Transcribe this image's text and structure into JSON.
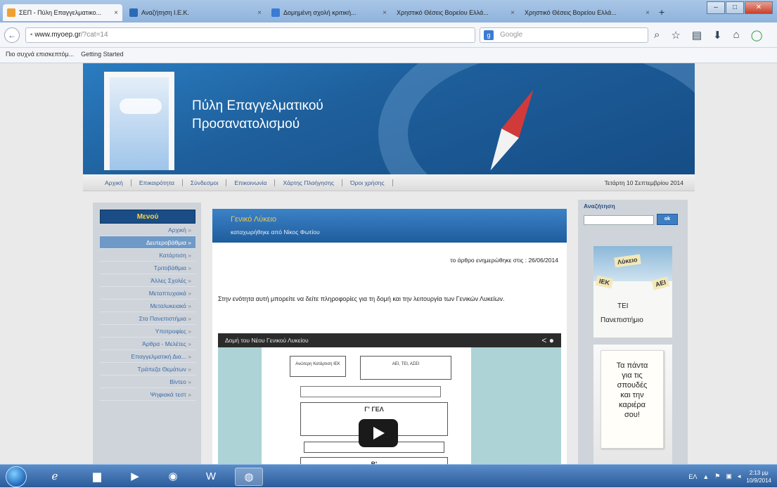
{
  "browser": {
    "tabs": [
      {
        "label": "ΣΕΠ - Πύλη Επαγγελματικο...",
        "active": true,
        "favicon_color": "#f0a030"
      },
      {
        "label": "Αναζήτηση Ι.Ε.Κ.",
        "active": false,
        "favicon_color": "#2a6bb5"
      },
      {
        "label": "Δομημένη σχολή κριτική...",
        "active": false,
        "favicon_color": "#3a7bd5"
      },
      {
        "label": "Χρηστικό Θέσεις Βορείου Ελλά...",
        "active": false,
        "favicon_color": ""
      },
      {
        "label": "Χρηστικό Θέσεις Βορείου Ελλά...",
        "active": false,
        "favicon_color": ""
      }
    ],
    "url_host": "www.myoep.gr",
    "url_path": "/?cat=14",
    "search_placeholder": "Google",
    "bookmarks": [
      "Πιο συχνά επισκεπτόμ...",
      "Getting Started"
    ]
  },
  "site": {
    "title_line1": "Πύλη Επαγγελματικού",
    "title_line2": "Προσανατολισμού",
    "nav": [
      "Αρχική",
      "Επικαιρότητα",
      "Σύνδεσμοι",
      "Επικοινωνία",
      "Χάρτης Πλοήγησης",
      "Όροι χρήσης"
    ],
    "date": "Τετάρτη 10 Σεπτεμβρίου 2014"
  },
  "sidebar": {
    "heading": "Μενού",
    "items": [
      "Αρχική",
      "Δευτεροβάθμια",
      "Κατάρτιση",
      "Τριτοβάθμια",
      "Άλλες Σχολές",
      "Μεταπτυχιακά",
      "Μεταλυκειακό",
      "Στα Πανεπιστήμια",
      "Υποτροφίες",
      "Άρθρα - Μελέτες",
      "Επαγγελματική Δια...",
      "Τράπεζα Θεμάτων",
      "Βίντεο",
      "Ψηφιακά τεστ"
    ],
    "selected_index": 1
  },
  "article": {
    "title": "Γενικό Λύκειο",
    "byline": "καταχωρήθηκε από Νίκος Φωτίου",
    "updated": "το άρθρο ενημερώθηκε στις : 26/06/2014",
    "body": "Στην ενότητα αυτή μπορείτε να δείτε πληροφορίες για τη δομή και την λειτουργία των Γενικών Λυκείων.",
    "video_title": "Δομή του Νέου Γενικού Λυκείου",
    "diagram_box1": "Ανώτερη Κατάρτιση ΙΕΚ",
    "diagram_box2": "ΑΕΙ, ΤΕΙ, ΑΣΕΙ",
    "diagram_grade_c": "Γ' ΓΕΛ",
    "diagram_grade_b": "Β'"
  },
  "right": {
    "search_label": "Αναζήτηση",
    "search_button": "ok",
    "ad1_signs": [
      "Λύκειο",
      "ΙΕΚ",
      "ΑΕΙ"
    ],
    "ad1_caption1": "ΤΕΙ",
    "ad1_caption2": "Πανεπιστήμιο",
    "ad2_text": [
      "Τα πάντα",
      "για τις",
      "σπουδές",
      "και την",
      "καριέρα",
      "σου!"
    ]
  },
  "taskbar": {
    "time": "2:13 μμ",
    "date": "10/9/2014"
  }
}
